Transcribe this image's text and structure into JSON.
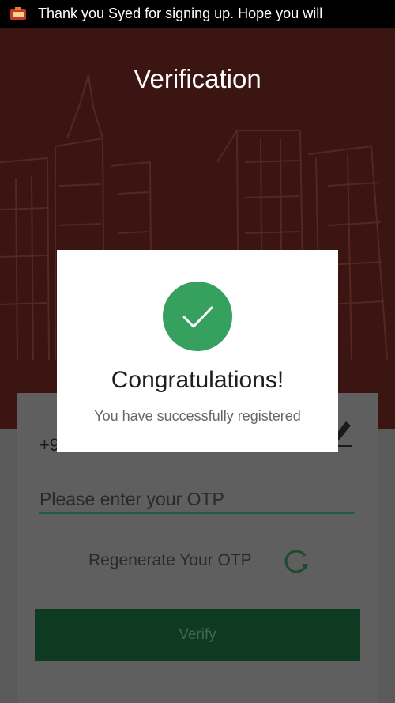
{
  "status_bar": {
    "notification_text": "Thank you Syed for signing up. Hope you will",
    "app_icon": "app-logo-icon"
  },
  "header": {
    "title": "Verification"
  },
  "form": {
    "phone_value": "+9",
    "otp_placeholder": "Please enter your OTP",
    "regenerate_label": "Regenerate Your OTP",
    "verify_label": "Verify"
  },
  "dialog": {
    "title": "Congratulations!",
    "message": "You have successfully registered",
    "icon": "checkmark-icon"
  },
  "colors": {
    "header_bg": "#3b1512",
    "success_green": "#36a05e",
    "verify_button": "#0e3a21",
    "otp_underline": "#1f5f3f"
  }
}
